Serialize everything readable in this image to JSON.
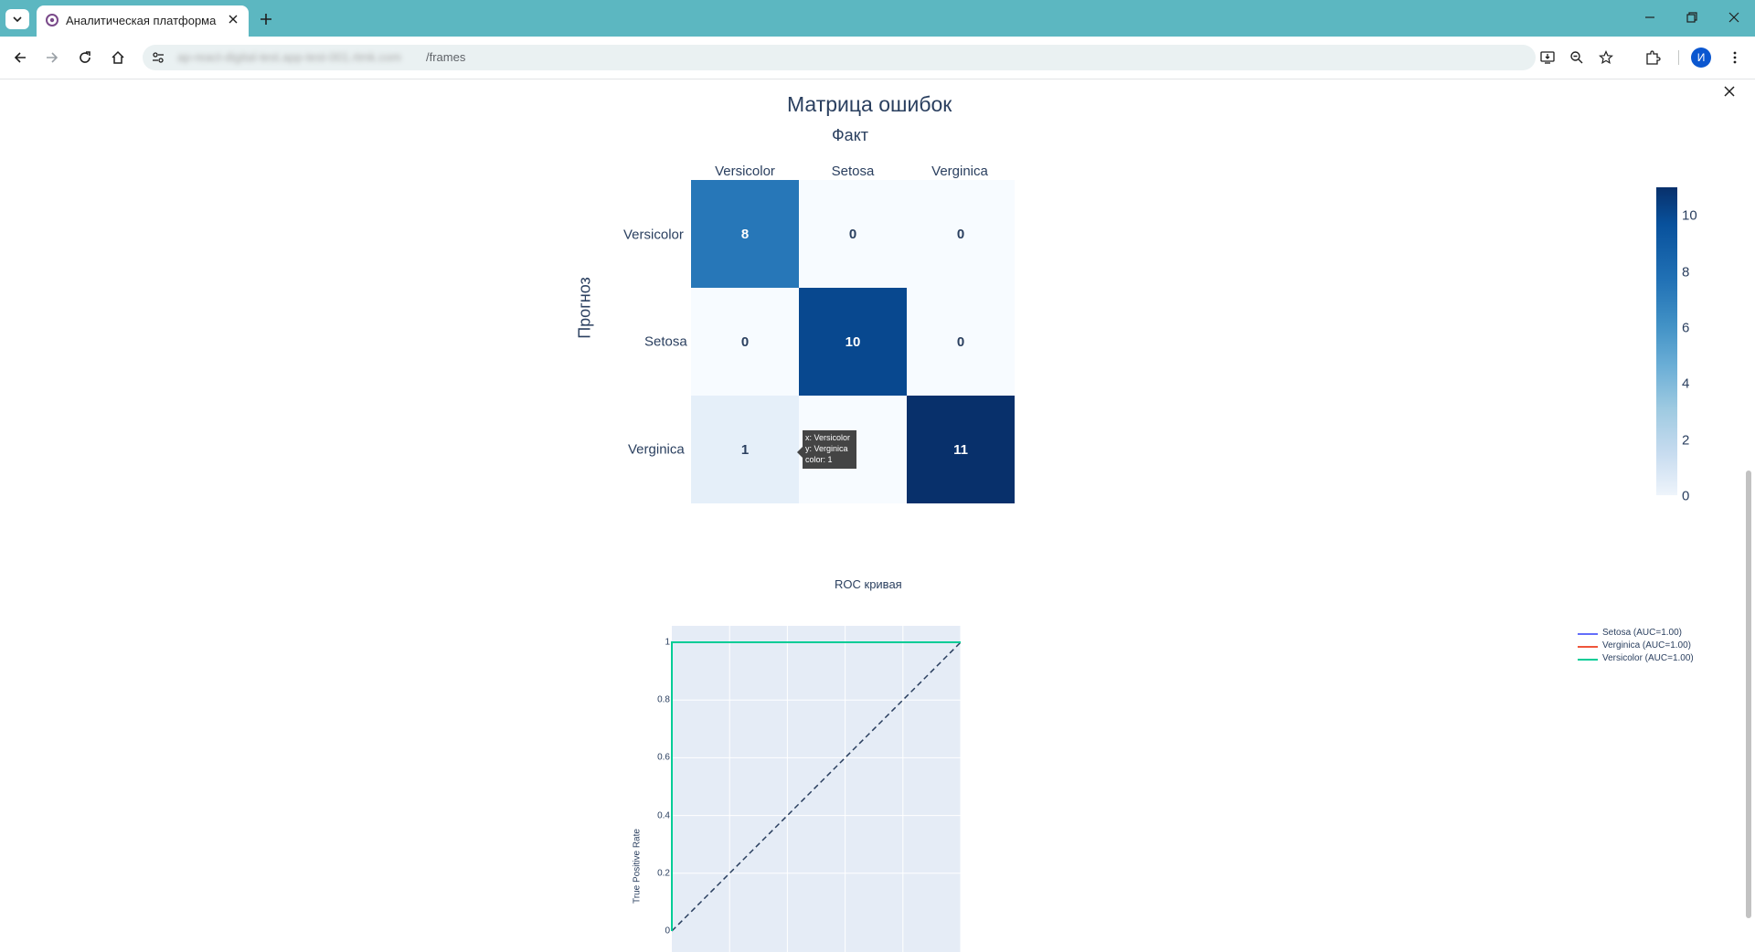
{
  "browser": {
    "tab_title": "Аналитическая платформа",
    "url_host": "ap-react-digital-test.app-test-001.rtmk.com",
    "url_path": "/frames",
    "profile_initial": "И"
  },
  "confusion_matrix": {
    "title": "Матрица ошибок",
    "x_title": "Факт",
    "y_title": "Прогноз",
    "columns": [
      "Versicolor",
      "Setosa",
      "Verginica"
    ],
    "rows": [
      "Versicolor",
      "Setosa",
      "Verginica"
    ],
    "colorbar_ticks": [
      "0",
      "2",
      "4",
      "6",
      "8",
      "10"
    ],
    "tooltip": {
      "x": "x: Versicolor",
      "y": "y: Verginica",
      "color": "color: 1"
    }
  },
  "roc": {
    "title": "ROC кривая",
    "y_label": "True Positive Rate",
    "y_ticks": [
      "0",
      "0.2",
      "0.4",
      "0.6",
      "0.8",
      "1"
    ],
    "legend": [
      {
        "label": "Setosa (AUC=1.00)",
        "color": "#636efa"
      },
      {
        "label": "Verginica (AUC=1.00)",
        "color": "#ef553b"
      },
      {
        "label": "Versicolor (AUC=1.00)",
        "color": "#00cc96"
      }
    ]
  },
  "chart_data": [
    {
      "type": "heatmap",
      "title": "Матрица ошибок",
      "xlabel": "Факт",
      "ylabel": "Прогноз",
      "x": [
        "Versicolor",
        "Setosa",
        "Verginica"
      ],
      "y": [
        "Versicolor",
        "Setosa",
        "Verginica"
      ],
      "z": [
        [
          8,
          0,
          0
        ],
        [
          0,
          10,
          0
        ],
        [
          1,
          0,
          11
        ]
      ],
      "colorscale": "Blues",
      "zlim": [
        0,
        11
      ]
    },
    {
      "type": "line",
      "title": "ROC кривая",
      "xlabel": "",
      "ylabel": "True Positive Rate",
      "xlim": [
        0,
        1
      ],
      "ylim": [
        0,
        1
      ],
      "grid": true,
      "legend_position": "top-right",
      "series": [
        {
          "name": "Setosa (AUC=1.00)",
          "x": [
            0,
            0,
            1
          ],
          "y": [
            0,
            1,
            1
          ]
        },
        {
          "name": "Verginica (AUC=1.00)",
          "x": [
            0,
            0,
            1
          ],
          "y": [
            0,
            1,
            1
          ]
        },
        {
          "name": "Versicolor (AUC=1.00)",
          "x": [
            0,
            0,
            1
          ],
          "y": [
            0,
            1,
            1
          ]
        }
      ],
      "reference_line": {
        "x": [
          0,
          1
        ],
        "y": [
          0,
          1
        ],
        "style": "dashed"
      }
    }
  ]
}
